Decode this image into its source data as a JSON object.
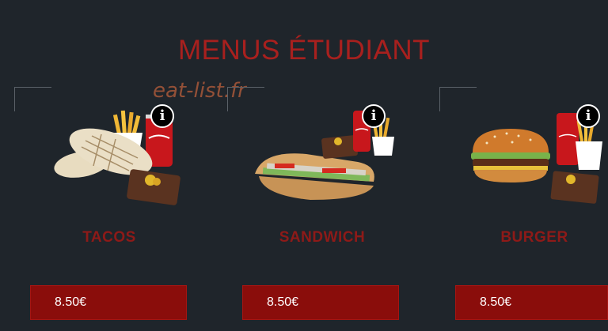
{
  "page": {
    "title": "MENUS ÉTUDIANT",
    "watermark": "eat-list.fr"
  },
  "colors": {
    "background": "#1f252b",
    "accent": "#a8201e",
    "button": "#8a0d0b"
  },
  "menus": [
    {
      "name": "TACOS",
      "price": "8.50€",
      "info_icon": "i"
    },
    {
      "name": "SANDWICH",
      "price": "8.50€",
      "info_icon": "i"
    },
    {
      "name": "BURGER",
      "price": "8.50€",
      "info_icon": "i"
    }
  ]
}
